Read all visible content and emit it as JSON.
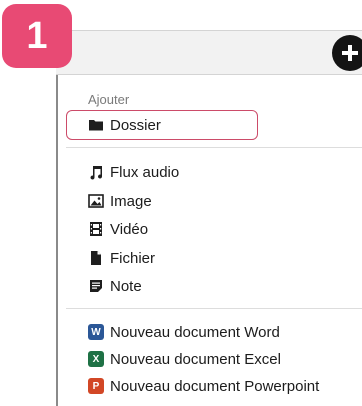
{
  "step": {
    "number": "1",
    "color": "#e84a74"
  },
  "toolbar": {
    "add_button_icon": "plus-icon"
  },
  "menu": {
    "section_label": "Ajouter",
    "highlight_color": "#cc4b69",
    "items": [
      {
        "label": "Dossier",
        "icon": "folder-icon"
      },
      {
        "label": "Flux audio",
        "icon": "music-note-icon"
      },
      {
        "label": "Image",
        "icon": "image-icon"
      },
      {
        "label": "Vidéo",
        "icon": "video-icon"
      },
      {
        "label": "Fichier",
        "icon": "file-icon"
      },
      {
        "label": "Note",
        "icon": "note-icon"
      },
      {
        "label": "Nouveau document Word",
        "icon": "word-icon",
        "badge": "W",
        "color": "#2b5797"
      },
      {
        "label": "Nouveau document Excel",
        "icon": "excel-icon",
        "badge": "X",
        "color": "#1e7145"
      },
      {
        "label": "Nouveau document Powerpoint",
        "icon": "powerpoint-icon",
        "badge": "P",
        "color": "#d24726"
      }
    ]
  }
}
